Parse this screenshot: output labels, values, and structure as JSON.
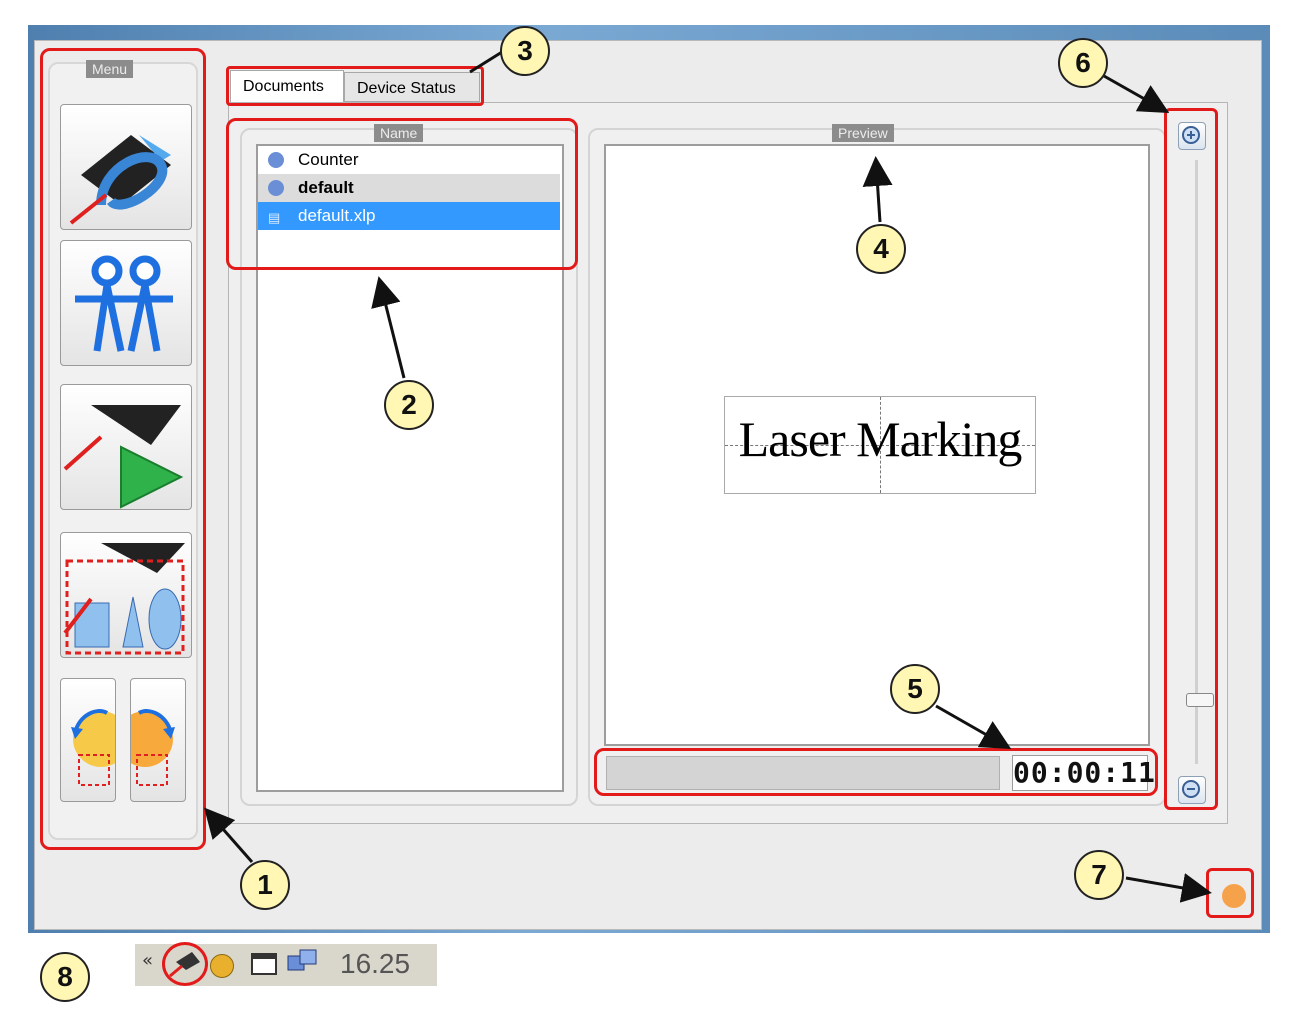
{
  "menu": {
    "label": "Menu"
  },
  "tabs": [
    {
      "label": "Documents",
      "active": true
    },
    {
      "label": "Device Status",
      "active": false
    }
  ],
  "documents_panel": {
    "header": "Name",
    "items": [
      {
        "label": "Counter",
        "icon": "gear-icon",
        "bold": false,
        "selected": false
      },
      {
        "label": "default",
        "icon": "gear-icon",
        "bold": true,
        "selected": false
      },
      {
        "label": "default.xlp",
        "icon": "document-icon",
        "bold": false,
        "selected": true
      }
    ]
  },
  "preview_panel": {
    "header": "Preview",
    "content_text": "Laser Marking",
    "timer": "00:00:11"
  },
  "zoom": {
    "in_icon": "zoom-in-icon",
    "out_icon": "zoom-out-icon",
    "level": 0.9
  },
  "callouts": [
    "1",
    "2",
    "3",
    "4",
    "5",
    "6",
    "7",
    "8"
  ],
  "taskbar": {
    "clock": "16.25"
  },
  "colors": {
    "annotation_red": "#e21a1a",
    "selection_blue": "#3399ff",
    "callout_fill": "#fff7b3"
  }
}
